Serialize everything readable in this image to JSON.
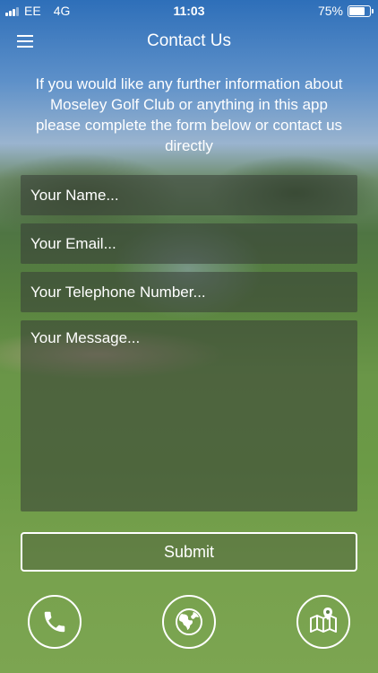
{
  "status_bar": {
    "carrier": "EE",
    "network": "4G",
    "time": "11:03",
    "battery_percent": "75%",
    "battery_level": 0.75
  },
  "header": {
    "title": "Contact Us",
    "menu_icon": "hamburger-menu-icon"
  },
  "intro_text": "If you would like any further information about Moseley Golf Club or anything in this app please complete the form below or contact us directly",
  "form": {
    "name_placeholder": "Your Name...",
    "email_placeholder": "Your Email...",
    "phone_placeholder": "Your Telephone Number...",
    "message_placeholder": "Your Message...",
    "submit_label": "Submit"
  },
  "contact_actions": [
    {
      "icon": "phone-icon"
    },
    {
      "icon": "globe-icon"
    },
    {
      "icon": "map-location-icon"
    }
  ],
  "colors": {
    "text": "#ffffff",
    "field_background": "rgba(55,60,55,0.55)"
  }
}
